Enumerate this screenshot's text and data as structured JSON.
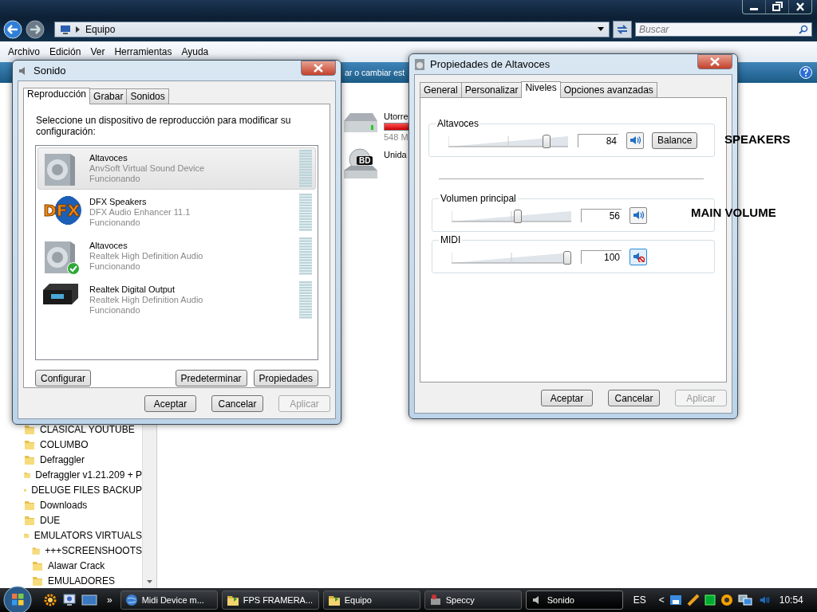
{
  "explorer": {
    "address": "Equipo",
    "search": {
      "placeholder": "Buscar"
    },
    "menu": [
      "Archivo",
      "Edición",
      "Ver",
      "Herramientas",
      "Ayuda"
    ],
    "command_text": "ar o cambiar est",
    "nav_items": [
      {
        "label": "CLASICAL YOUTUBE"
      },
      {
        "label": "COLUMBO"
      },
      {
        "label": "Defraggler"
      },
      {
        "label": "Defraggler v1.21.209 + P"
      },
      {
        "label": "DELUGE FILES BACKUP"
      },
      {
        "label": "Downloads"
      },
      {
        "label": "DUE"
      },
      {
        "label": "EMULATORS VIRTUALS",
        "children": [
          {
            "label": "+++SCREENSHOOTS"
          },
          {
            "label": "Alawar Crack"
          },
          {
            "label": "EMULADORES"
          }
        ]
      }
    ],
    "drives": [
      {
        "kind": "hdd",
        "name": "Utorre",
        "detail": "548 M"
      },
      {
        "kind": "bd",
        "name": "Unida",
        "badge": "BD"
      }
    ]
  },
  "sound_dialog": {
    "title": "Sonido",
    "tabs": [
      {
        "label": "Reproducción",
        "selected": true
      },
      {
        "label": "Grabar",
        "selected": false
      },
      {
        "label": "Sonidos",
        "selected": false
      }
    ],
    "instruction": "Seleccione un dispositivo de reproducción para modificar su configuración:",
    "devices": [
      {
        "kind": "speaker",
        "name": "Altavoces",
        "driver": "AnvSoft Virtual Sound Device",
        "status": "Funcionando",
        "selected": true,
        "default": false
      },
      {
        "kind": "dfx",
        "icon_text": "DFX",
        "name": "DFX Speakers",
        "driver": "DFX Audio Enhancer 11.1",
        "status": "Funcionando",
        "selected": false,
        "default": false
      },
      {
        "kind": "speaker",
        "name": "Altavoces",
        "driver": "Realtek High Definition Audio",
        "status": "Funcionando",
        "selected": false,
        "default": true
      },
      {
        "kind": "receiver",
        "name": "Realtek Digital Output",
        "driver": "Realtek High Definition Audio",
        "status": "Funcionando",
        "selected": false,
        "default": false
      }
    ],
    "left_button": "Configurar",
    "right_buttons": [
      "Predeterminar",
      "Propiedades"
    ],
    "footer": [
      {
        "label": "Aceptar",
        "disabled": false
      },
      {
        "label": "Cancelar",
        "disabled": false
      },
      {
        "label": "Aplicar",
        "disabled": true
      }
    ]
  },
  "properties_dialog": {
    "title": "Propiedades de Altavoces",
    "tabs": [
      {
        "label": "General",
        "selected": false
      },
      {
        "label": "Personalizar",
        "selected": false
      },
      {
        "label": "Niveles",
        "selected": true
      },
      {
        "label": "Opciones avanzadas",
        "selected": false
      }
    ],
    "sections": [
      [
        {
          "label": "Altavoces",
          "level": 0.84,
          "value": "84",
          "muted": false,
          "balance": "Balance"
        }
      ],
      [
        {
          "label": "Volumen principal",
          "level": 0.56,
          "value": "56",
          "muted": false
        },
        {
          "label": "MIDI",
          "level": 1,
          "value": "100",
          "muted": true
        }
      ]
    ],
    "footer": [
      {
        "label": "Aceptar",
        "disabled": false
      },
      {
        "label": "Cancelar",
        "disabled": false
      },
      {
        "label": "Aplicar",
        "disabled": true
      }
    ]
  },
  "annotations": [
    "SPEAKERS",
    "MAIN VOLUME"
  ],
  "taskbar": {
    "overflow": "»",
    "tasks": [
      {
        "label": "Midi Device m...",
        "kind": "globe",
        "selected": false
      },
      {
        "label": "FPS FRAMERA...",
        "kind": "folder",
        "selected": false
      },
      {
        "label": "Equipo",
        "kind": "folder",
        "selected": false
      },
      {
        "label": "Speccy",
        "kind": "app",
        "selected": false
      },
      {
        "label": "Sonido",
        "kind": "speaker",
        "selected": true
      }
    ],
    "language": "ES",
    "tray_chevron": "<",
    "clock": "10:54"
  }
}
